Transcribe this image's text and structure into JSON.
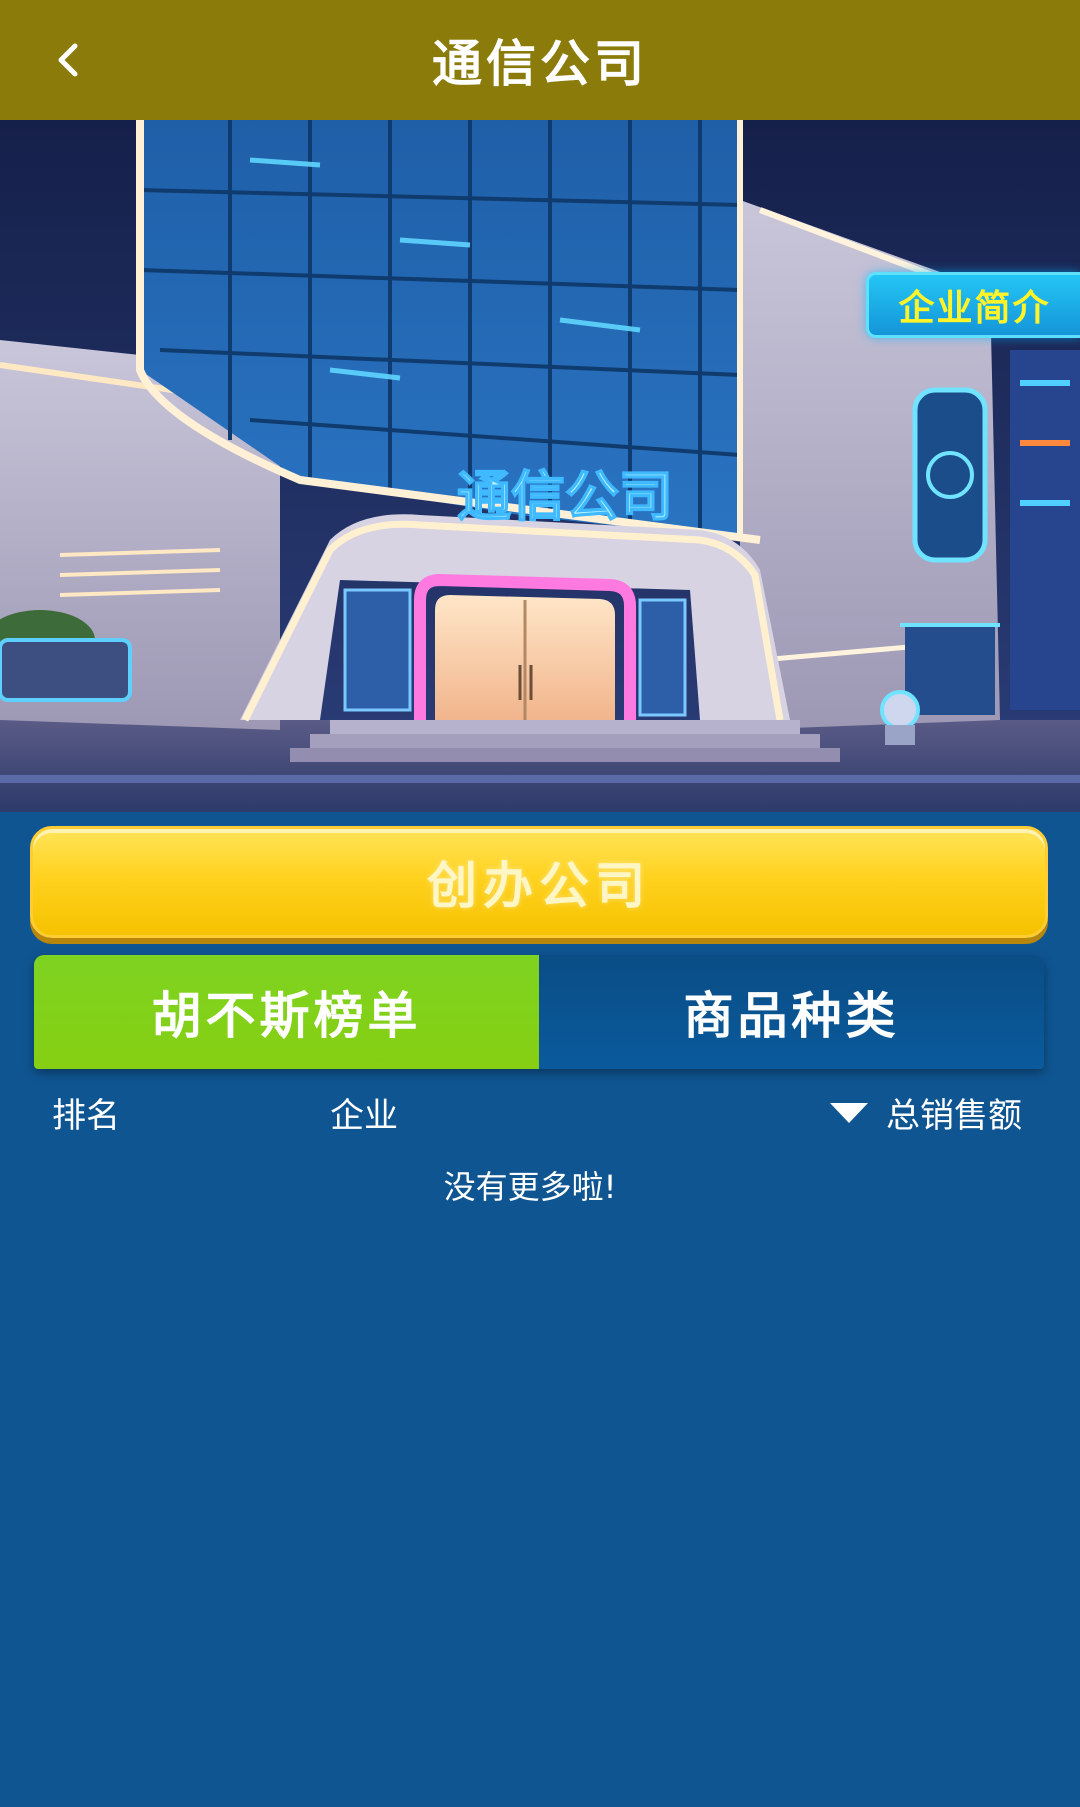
{
  "header": {
    "title": "通信公司",
    "back_icon": "chevron-left-icon"
  },
  "hero": {
    "image": "building-illustration",
    "sign_text": "通信公司",
    "intro_label": "企业简介"
  },
  "create_button": {
    "label": "创办公司"
  },
  "tabs": [
    {
      "label": "胡不斯榜单",
      "active": true
    },
    {
      "label": "商品种类",
      "active": false
    }
  ],
  "table": {
    "columns": {
      "rank": "排名",
      "company": "企业",
      "sales": "总销售额"
    },
    "sort_icon": "caret-down-icon",
    "empty_text": "没有更多啦!"
  },
  "colors": {
    "header_bg": "#8a7b0a",
    "page_bg": "#0f5592",
    "tab_active": "#86cf12",
    "tab_inactive": "#0a5a9c",
    "button_yellow": "#ffd21f",
    "intro_badge": "#1495d8",
    "intro_text": "#fff42a"
  }
}
